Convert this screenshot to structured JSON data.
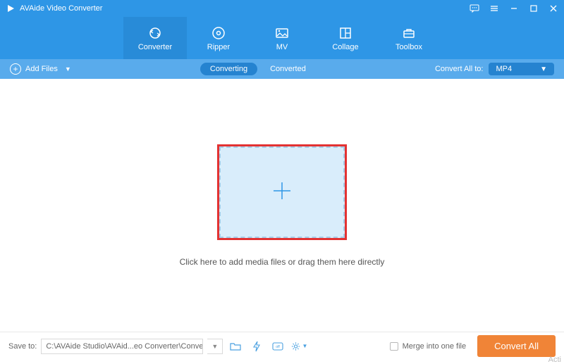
{
  "app": {
    "title": "AVAide Video Converter"
  },
  "nav": {
    "items": [
      {
        "label": "Converter"
      },
      {
        "label": "Ripper"
      },
      {
        "label": "MV"
      },
      {
        "label": "Collage"
      },
      {
        "label": "Toolbox"
      }
    ]
  },
  "toolbar": {
    "add_files": "Add Files",
    "converting": "Converting",
    "converted": "Converted",
    "convert_all_to_label": "Convert All to:",
    "format": "MP4"
  },
  "main": {
    "drop_text": "Click here to add media files or drag them here directly"
  },
  "footer": {
    "save_to_label": "Save to:",
    "save_path": "C:\\AVAide Studio\\AVAid...eo Converter\\Converted",
    "merge_label": "Merge into one file",
    "convert_all": "Convert All"
  },
  "watermark": "Acti"
}
